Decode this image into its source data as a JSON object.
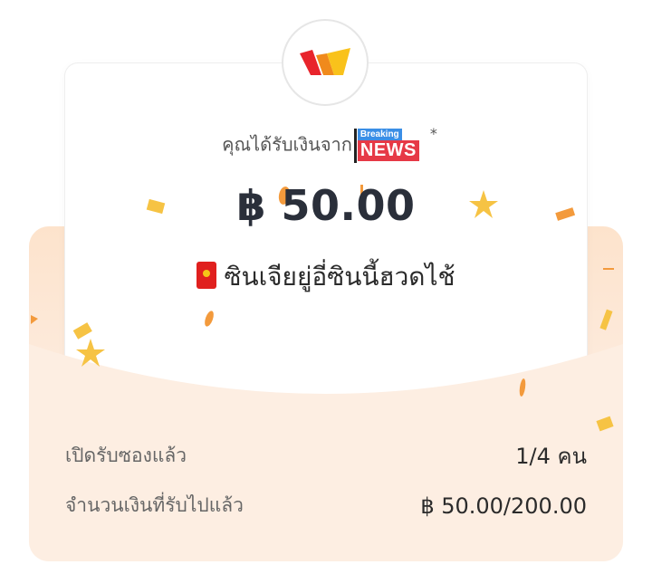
{
  "sender": {
    "prefix": "คุณได้รับเงินจาก",
    "badge_top": "Breaking",
    "badge_main": "NEWS",
    "suffix": "*"
  },
  "amount": "฿ 50.00",
  "message": "ซินเจียยู่อี่ซินนี้ฮวดไช้",
  "stats": {
    "opened_label": "เปิดรับซองแล้ว",
    "opened_value": "1/4 คน",
    "received_label": "จำนวนเงินที่รับไปแล้ว",
    "received_value": "฿ 50.00/200.00"
  },
  "colors": {
    "envelope": "#fde3cc",
    "confetti_orange": "#f39a3c",
    "confetti_yellow": "#f6c344",
    "logo_red": "#e8242c",
    "logo_yellow": "#f9c21b"
  }
}
